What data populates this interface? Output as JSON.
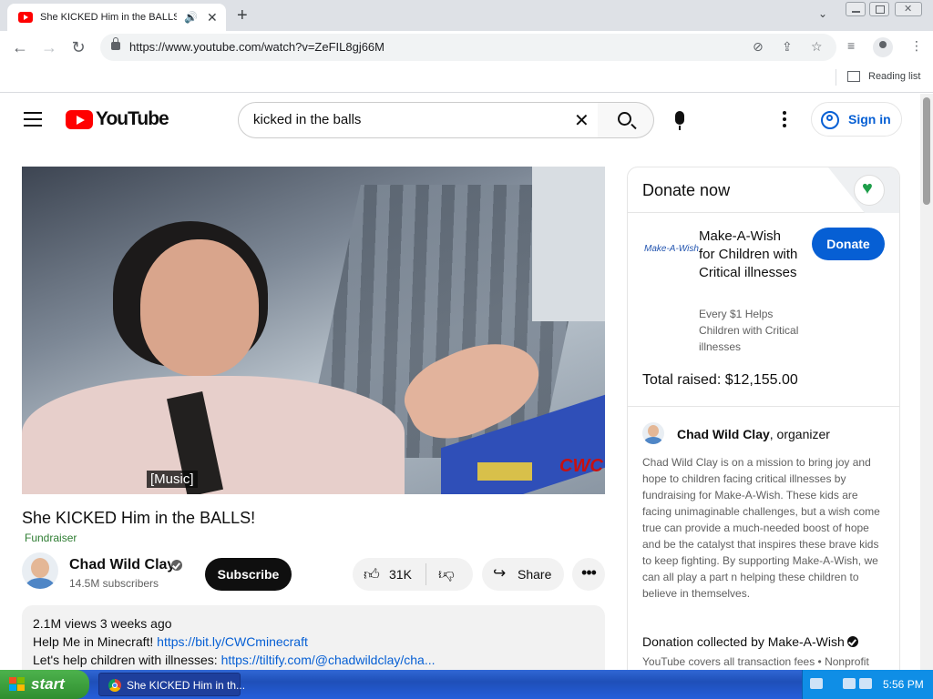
{
  "browser": {
    "tab_title": "She KICKED Him in the BALLS!",
    "url": "https://www.youtube.com/watch?v=ZeFIL8gj66M",
    "reading_list": "Reading list"
  },
  "youtube": {
    "logo_text": "YouTube",
    "search_value": "kicked in the balls",
    "signin": "Sign in"
  },
  "video": {
    "caption": "[Music]",
    "watermark": "CWC",
    "title": "She KICKED Him in the BALLS!",
    "fundraiser_badge": "Fundraiser",
    "channel_name": "Chad Wild Clay",
    "subscribers": "14.5M subscribers",
    "subscribe": "Subscribe",
    "likes": "31K",
    "share": "Share",
    "more": "•••",
    "description": {
      "meta": "2.1M views  3 weeks ago",
      "line1_text": "Help Me in Minecraft! ",
      "line1_link": "https://bit.ly/CWCminecraft",
      "line2_text": "Let's help children with illnesses: ",
      "line2_link": "https://tiltify.com/@chadwildclay/cha..."
    }
  },
  "donate": {
    "header": "Donate now",
    "org_logo": "Make-A-Wish",
    "org_name": "Make-A-Wish for Children with Critical illnesses",
    "donate_button": "Donate",
    "org_tagline": "Every $1 Helps Children with Critical illnesses",
    "total_raised": "Total raised: $12,155.00",
    "organizer_name": "Chad Wild Clay",
    "organizer_suffix": ", organizer",
    "organizer_description": "Chad Wild Clay is on a mission to bring joy and hope to children facing critical illnesses by fundraising for Make-A-Wish. These kids are facing unimaginable challenges, but a wish come true can provide a much-needed boost of hope and be the catalyst that inspires these brave kids to keep fighting. By supporting Make-A-Wish, we can all play a part n helping these children to believe in themselves.",
    "collected_by": "Donation collected by Make-A-Wish",
    "fees_note": "YouTube covers all transaction fees  •  Nonprofit website"
  },
  "taskbar": {
    "start": "start",
    "task_label": "She KICKED Him in th...",
    "clock": "5:56 PM"
  },
  "colors": {
    "youtube_red": "#ff0000",
    "link_blue": "#065fd4",
    "fundraiser_green": "#2e7d32",
    "xp_taskbar": "#245edb",
    "xp_start": "#3c9f3c"
  }
}
